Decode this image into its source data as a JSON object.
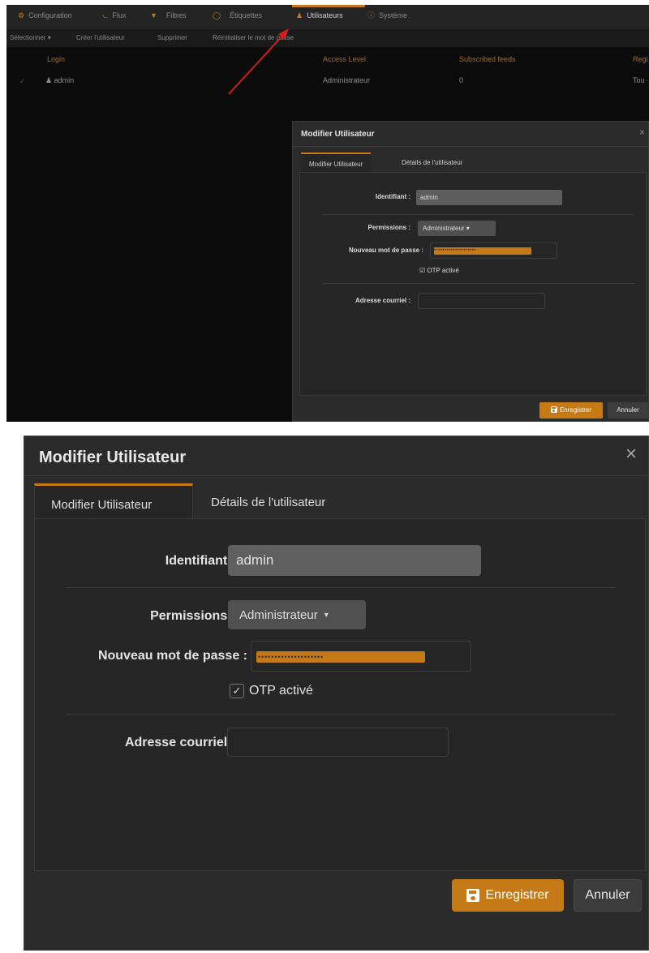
{
  "background": {
    "nav_tabs": [
      {
        "label": "Configuration",
        "icon": "gear-icon",
        "glyph": "⚙"
      },
      {
        "label": "Flux",
        "icon": "rss-icon",
        "glyph": ")"
      },
      {
        "label": "Filtres",
        "icon": "filter-icon",
        "glyph": "▼"
      },
      {
        "label": "Étiquettes",
        "icon": "tag-icon",
        "glyph": "◯"
      },
      {
        "label": "Utilisateurs",
        "icon": "user-icon",
        "glyph": "👤"
      },
      {
        "label": "Système",
        "icon": "info-icon",
        "glyph": "ⓘ"
      }
    ],
    "active_tab": "Utilisateurs",
    "actions": [
      "Sélectionner ▾",
      "Créer l'utilisateur",
      "Supprimer",
      "Réinitialiser le mot de passe"
    ],
    "columns": [
      "Login",
      "Access Level",
      "Subscribed feeds",
      "Regi"
    ],
    "rows": [
      {
        "login": "admin",
        "access_level": "Administrateur",
        "subscribed_feeds": "0",
        "registered": "Tou"
      }
    ],
    "accent_color": "#c57a17"
  },
  "dialog": {
    "title": "Modifier Utilisateur",
    "close_glyph": "×",
    "tabs": [
      {
        "label": "Modifier Utilisateur",
        "active": true
      },
      {
        "label": "Détails de l'utilisateur",
        "active": false
      }
    ],
    "fields": {
      "login_label": "Identifiant :",
      "login_value": "admin",
      "permissions_label": "Permissions :",
      "permissions_value": "Administrateur",
      "password_label": "Nouveau mot de passe :",
      "password_mask": "••••••••••••••••••••",
      "otp_label": "OTP activé",
      "otp_checked": true,
      "email_label": "Adresse courriel :",
      "email_value": ""
    },
    "buttons": {
      "save": "Enregistrer",
      "cancel": "Annuler"
    }
  }
}
